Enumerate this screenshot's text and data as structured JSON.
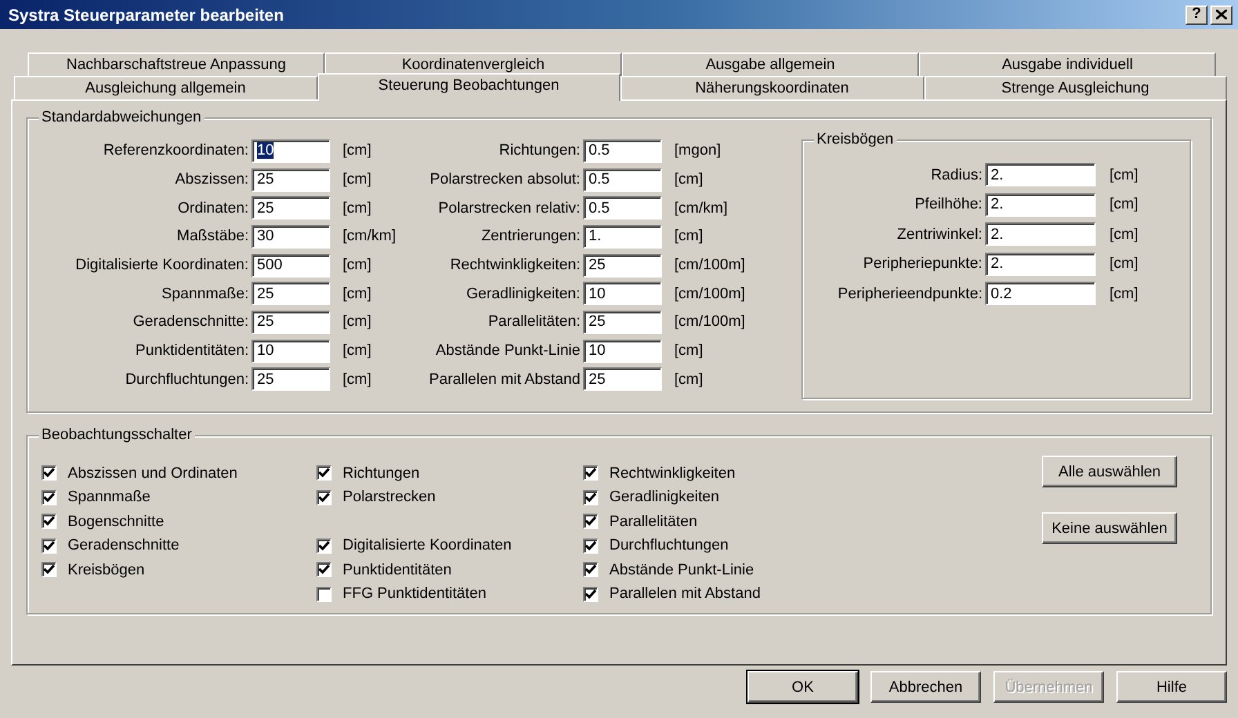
{
  "window": {
    "title": "Systra Steuerparameter bearbeiten",
    "help": "?"
  },
  "tabs": [
    [
      {
        "label": "Nachbarschaftstreue Anpassung",
        "selected": false
      },
      {
        "label": "Koordinatenvergleich",
        "selected": false
      },
      {
        "label": "Ausgabe allgemein",
        "selected": false
      },
      {
        "label": "Ausgabe individuell",
        "selected": false
      }
    ],
    [
      {
        "label": "Ausgleichung allgemein",
        "selected": false
      },
      {
        "label": "Steuerung Beobachtungen",
        "selected": true
      },
      {
        "label": "Näherungskoordinaten",
        "selected": false
      },
      {
        "label": "Strenge Ausgleichung",
        "selected": false
      }
    ]
  ],
  "standard": {
    "title": "Standardabweichungen",
    "columns": [
      [
        {
          "label": "Referenzkoordinaten:",
          "value": "10",
          "unit": "[cm]",
          "focused": true
        },
        {
          "label": "Abszissen:",
          "value": "25",
          "unit": "[cm]",
          "focused": false
        },
        {
          "label": "Ordinaten:",
          "value": "25",
          "unit": "[cm]",
          "focused": false
        },
        {
          "label": "Maßstäbe:",
          "value": "30",
          "unit": "[cm/km]",
          "focused": false
        },
        {
          "label": "Digitalisierte Koordinaten:",
          "value": "500",
          "unit": "[cm]",
          "focused": false
        },
        {
          "label": "Spannmaße:",
          "value": "25",
          "unit": "[cm]",
          "focused": false
        },
        {
          "label": "Geradenschnitte:",
          "value": "25",
          "unit": "[cm]",
          "focused": false
        },
        {
          "label": "Punktidentitäten:",
          "value": "10",
          "unit": "[cm]",
          "focused": false
        },
        {
          "label": "Durchfluchtungen:",
          "value": "25",
          "unit": "[cm]",
          "focused": false
        }
      ],
      [
        {
          "label": "Richtungen:",
          "value": "0.5",
          "unit": "[mgon]",
          "focused": false
        },
        {
          "label": "Polarstrecken absolut:",
          "value": "0.5",
          "unit": "[cm]",
          "focused": false
        },
        {
          "label": "Polarstrecken relativ:",
          "value": "0.5",
          "unit": "[cm/km]",
          "focused": false
        },
        {
          "label": "Zentrierungen:",
          "value": "1.",
          "unit": "[cm]",
          "focused": false
        },
        {
          "label": "Rechtwinkligkeiten:",
          "value": "25",
          "unit": "[cm/100m]",
          "focused": false
        },
        {
          "label": "Geradlinigkeiten:",
          "value": "10",
          "unit": "[cm/100m]",
          "focused": false
        },
        {
          "label": "Parallelitäten:",
          "value": "25",
          "unit": "[cm/100m]",
          "focused": false
        },
        {
          "label": "Abstände Punkt-Linie",
          "value": "10",
          "unit": "[cm]",
          "focused": false
        },
        {
          "label": "Parallelen mit Abstand",
          "value": "25",
          "unit": "[cm]",
          "focused": false
        }
      ]
    ]
  },
  "arcs": {
    "title": "Kreisbögen",
    "fields": [
      {
        "label": "Radius:",
        "value": "2.",
        "unit": "[cm]"
      },
      {
        "label": "Pfeilhöhe:",
        "value": "2.",
        "unit": "[cm]"
      },
      {
        "label": "Zentriwinkel:",
        "value": "2.",
        "unit": "[cm]"
      },
      {
        "label": "Peripheriepunkte:",
        "value": "2.",
        "unit": "[cm]"
      },
      {
        "label": "Peripherieendpunkte:",
        "value": "0.2",
        "unit": "[cm]"
      }
    ]
  },
  "switches": {
    "title": "Beobachtungsschalter",
    "columns": [
      [
        {
          "kind": "checkbox",
          "label": "Abszissen und Ordinaten",
          "checked": true
        },
        {
          "kind": "checkbox",
          "label": "Spannmaße",
          "checked": true
        },
        {
          "kind": "checkbox",
          "label": "Bogenschnitte",
          "checked": true
        },
        {
          "kind": "checkbox",
          "label": "Geradenschnitte",
          "checked": true
        },
        {
          "kind": "checkbox",
          "label": "Kreisbögen",
          "checked": true
        }
      ],
      [
        {
          "kind": "checkbox",
          "label": "Richtungen",
          "checked": true
        },
        {
          "kind": "checkbox",
          "label": "Polarstrecken",
          "checked": true
        },
        {
          "kind": "spacer"
        },
        {
          "kind": "checkbox",
          "label": "Digitalisierte Koordinaten",
          "checked": true
        },
        {
          "kind": "checkbox",
          "label": "Punktidentitäten",
          "checked": true
        },
        {
          "kind": "checkbox",
          "label": "FFG Punktidentitäten",
          "checked": false
        }
      ],
      [
        {
          "kind": "checkbox",
          "label": "Rechtwinkligkeiten",
          "checked": true
        },
        {
          "kind": "checkbox",
          "label": "Geradlinigkeiten",
          "checked": true
        },
        {
          "kind": "checkbox",
          "label": "Parallelitäten",
          "checked": true
        },
        {
          "kind": "checkbox",
          "label": "Durchfluchtungen",
          "checked": true
        },
        {
          "kind": "checkbox",
          "label": "Abstände Punkt-Linie",
          "checked": true
        },
        {
          "kind": "checkbox",
          "label": "Parallelen mit Abstand",
          "checked": true
        }
      ]
    ],
    "buttons": [
      "Alle auswählen",
      "Keine auswählen"
    ]
  },
  "dialog_buttons": [
    {
      "label": "OK",
      "default": true,
      "disabled": false
    },
    {
      "label": "Abbrechen",
      "default": false,
      "disabled": false
    },
    {
      "label": "Übernehmen",
      "default": false,
      "disabled": true
    },
    {
      "label": "Hilfe",
      "default": false,
      "disabled": false
    }
  ]
}
